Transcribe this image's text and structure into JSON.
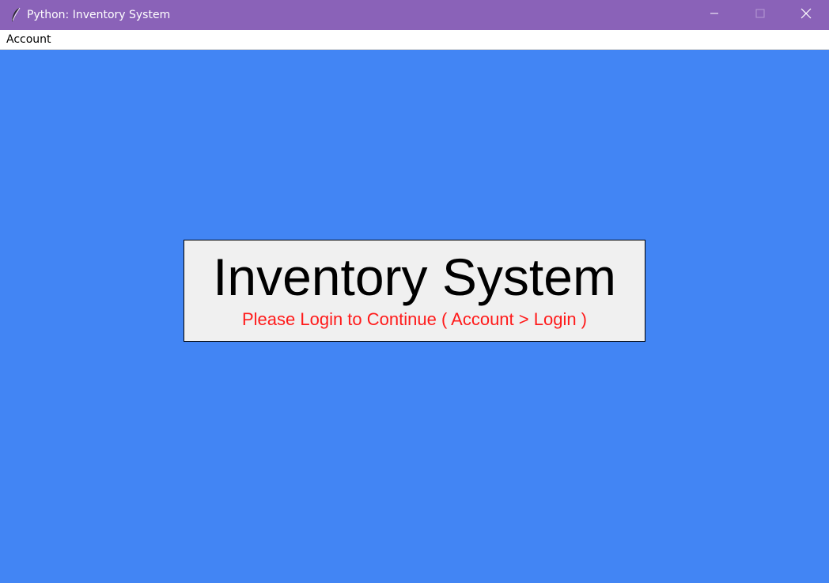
{
  "window": {
    "title": "Python: Inventory System",
    "icon": "feather-icon",
    "titlebar_color": "#8a62b8",
    "background_color": "#4285f4"
  },
  "menubar": {
    "items": [
      {
        "label": "Account"
      }
    ]
  },
  "panel": {
    "title": "Inventory System",
    "subtitle": "Please Login to Continue ( Account > Login )",
    "subtitle_color": "#ff1a1a"
  },
  "controls": {
    "minimize_icon": "minimize-icon",
    "maximize_icon": "maximize-icon",
    "close_icon": "close-icon"
  }
}
